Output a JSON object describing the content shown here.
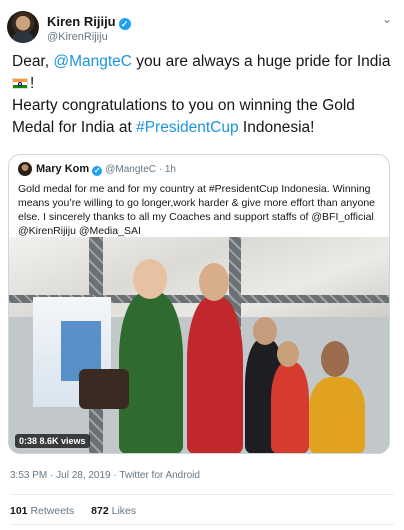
{
  "author": {
    "name": "Kiren Rijiju",
    "handle": "@KirenRijiju",
    "verified_icon": "verified-badge-icon"
  },
  "tweet": {
    "dear": "Dear, ",
    "mention": "@MangteC",
    "line1_rest": " you are always a huge pride for India",
    "flag_icon": "india-flag-icon",
    "after_flag": "!",
    "line2": "Hearty congratulations to you on winning the Gold Medal for India at ",
    "hashtag": "#PresidentCup",
    "line2_end": " Indonesia!"
  },
  "quoted": {
    "name": "Mary Kom",
    "handle": "@MangteC · 1h",
    "text": "Gold medal for me and for my country at #PresidentCup Indonesia. Winning means you’re willing to go longer,work harder & give more effort than anyone else. I sincerely thanks to all my Coaches and support staffs of @BFI_official @KirenRijiju @Media_SAI",
    "video_badge": "0:38  8.6K views",
    "video_icon": "video-thumbnail"
  },
  "meta": {
    "timestamp": "3:53 PM · Jul 28, 2019 · Twitter for Android"
  },
  "stats": {
    "retweets_count": "101",
    "retweets_label": "Retweets",
    "likes_count": "872",
    "likes_label": "Likes"
  },
  "colors": {
    "link": "#1b95e0",
    "verified": "#1da1f2",
    "muted": "#657786"
  }
}
